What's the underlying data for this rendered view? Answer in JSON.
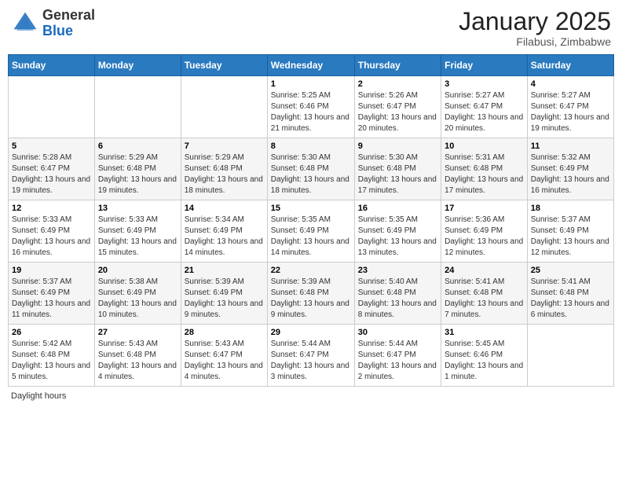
{
  "header": {
    "logo_general": "General",
    "logo_blue": "Blue",
    "month_title": "January 2025",
    "subtitle": "Filabusi, Zimbabwe"
  },
  "days_of_week": [
    "Sunday",
    "Monday",
    "Tuesday",
    "Wednesday",
    "Thursday",
    "Friday",
    "Saturday"
  ],
  "weeks": [
    [
      {
        "day": "",
        "info": ""
      },
      {
        "day": "",
        "info": ""
      },
      {
        "day": "",
        "info": ""
      },
      {
        "day": "1",
        "info": "Sunrise: 5:25 AM\nSunset: 6:46 PM\nDaylight: 13 hours and 21 minutes."
      },
      {
        "day": "2",
        "info": "Sunrise: 5:26 AM\nSunset: 6:47 PM\nDaylight: 13 hours and 20 minutes."
      },
      {
        "day": "3",
        "info": "Sunrise: 5:27 AM\nSunset: 6:47 PM\nDaylight: 13 hours and 20 minutes."
      },
      {
        "day": "4",
        "info": "Sunrise: 5:27 AM\nSunset: 6:47 PM\nDaylight: 13 hours and 19 minutes."
      }
    ],
    [
      {
        "day": "5",
        "info": "Sunrise: 5:28 AM\nSunset: 6:47 PM\nDaylight: 13 hours and 19 minutes."
      },
      {
        "day": "6",
        "info": "Sunrise: 5:29 AM\nSunset: 6:48 PM\nDaylight: 13 hours and 19 minutes."
      },
      {
        "day": "7",
        "info": "Sunrise: 5:29 AM\nSunset: 6:48 PM\nDaylight: 13 hours and 18 minutes."
      },
      {
        "day": "8",
        "info": "Sunrise: 5:30 AM\nSunset: 6:48 PM\nDaylight: 13 hours and 18 minutes."
      },
      {
        "day": "9",
        "info": "Sunrise: 5:30 AM\nSunset: 6:48 PM\nDaylight: 13 hours and 17 minutes."
      },
      {
        "day": "10",
        "info": "Sunrise: 5:31 AM\nSunset: 6:48 PM\nDaylight: 13 hours and 17 minutes."
      },
      {
        "day": "11",
        "info": "Sunrise: 5:32 AM\nSunset: 6:49 PM\nDaylight: 13 hours and 16 minutes."
      }
    ],
    [
      {
        "day": "12",
        "info": "Sunrise: 5:33 AM\nSunset: 6:49 PM\nDaylight: 13 hours and 16 minutes."
      },
      {
        "day": "13",
        "info": "Sunrise: 5:33 AM\nSunset: 6:49 PM\nDaylight: 13 hours and 15 minutes."
      },
      {
        "day": "14",
        "info": "Sunrise: 5:34 AM\nSunset: 6:49 PM\nDaylight: 13 hours and 14 minutes."
      },
      {
        "day": "15",
        "info": "Sunrise: 5:35 AM\nSunset: 6:49 PM\nDaylight: 13 hours and 14 minutes."
      },
      {
        "day": "16",
        "info": "Sunrise: 5:35 AM\nSunset: 6:49 PM\nDaylight: 13 hours and 13 minutes."
      },
      {
        "day": "17",
        "info": "Sunrise: 5:36 AM\nSunset: 6:49 PM\nDaylight: 13 hours and 12 minutes."
      },
      {
        "day": "18",
        "info": "Sunrise: 5:37 AM\nSunset: 6:49 PM\nDaylight: 13 hours and 12 minutes."
      }
    ],
    [
      {
        "day": "19",
        "info": "Sunrise: 5:37 AM\nSunset: 6:49 PM\nDaylight: 13 hours and 11 minutes."
      },
      {
        "day": "20",
        "info": "Sunrise: 5:38 AM\nSunset: 6:49 PM\nDaylight: 13 hours and 10 minutes."
      },
      {
        "day": "21",
        "info": "Sunrise: 5:39 AM\nSunset: 6:49 PM\nDaylight: 13 hours and 9 minutes."
      },
      {
        "day": "22",
        "info": "Sunrise: 5:39 AM\nSunset: 6:48 PM\nDaylight: 13 hours and 9 minutes."
      },
      {
        "day": "23",
        "info": "Sunrise: 5:40 AM\nSunset: 6:48 PM\nDaylight: 13 hours and 8 minutes."
      },
      {
        "day": "24",
        "info": "Sunrise: 5:41 AM\nSunset: 6:48 PM\nDaylight: 13 hours and 7 minutes."
      },
      {
        "day": "25",
        "info": "Sunrise: 5:41 AM\nSunset: 6:48 PM\nDaylight: 13 hours and 6 minutes."
      }
    ],
    [
      {
        "day": "26",
        "info": "Sunrise: 5:42 AM\nSunset: 6:48 PM\nDaylight: 13 hours and 5 minutes."
      },
      {
        "day": "27",
        "info": "Sunrise: 5:43 AM\nSunset: 6:48 PM\nDaylight: 13 hours and 4 minutes."
      },
      {
        "day": "28",
        "info": "Sunrise: 5:43 AM\nSunset: 6:47 PM\nDaylight: 13 hours and 4 minutes."
      },
      {
        "day": "29",
        "info": "Sunrise: 5:44 AM\nSunset: 6:47 PM\nDaylight: 13 hours and 3 minutes."
      },
      {
        "day": "30",
        "info": "Sunrise: 5:44 AM\nSunset: 6:47 PM\nDaylight: 13 hours and 2 minutes."
      },
      {
        "day": "31",
        "info": "Sunrise: 5:45 AM\nSunset: 6:46 PM\nDaylight: 13 hours and 1 minute."
      },
      {
        "day": "",
        "info": ""
      }
    ]
  ],
  "footer": {
    "daylight_label": "Daylight hours"
  }
}
